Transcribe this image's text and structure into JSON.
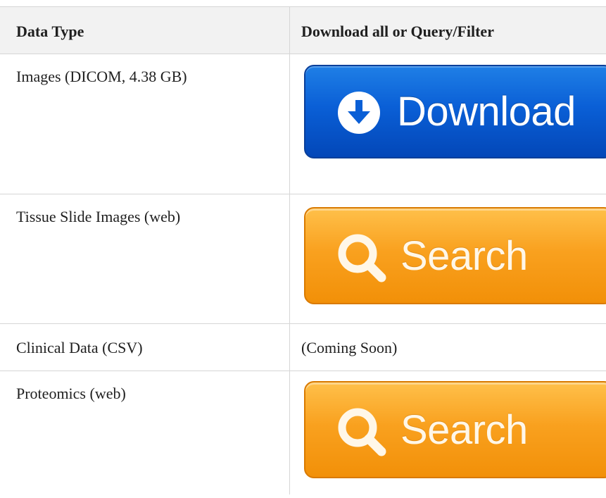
{
  "table": {
    "headers": [
      "Data Type",
      "Download all or Query/Filter"
    ],
    "rows": [
      {
        "data_type": "Images (DICOM, 4.38 GB)",
        "action": {
          "kind": "button",
          "label": "Download",
          "icon": "download-circle-icon",
          "color": "#0a5fd6"
        }
      },
      {
        "data_type": "Tissue Slide Images (web)",
        "action": {
          "kind": "button",
          "label": "Search",
          "icon": "search-icon",
          "color": "#f9a11f"
        }
      },
      {
        "data_type": "Clinical Data (CSV)",
        "action": {
          "kind": "text",
          "label": "(Coming Soon)"
        }
      },
      {
        "data_type": "Proteomics (web)",
        "action": {
          "kind": "button",
          "label": "Search",
          "icon": "search-icon",
          "color": "#f9a11f"
        }
      }
    ]
  },
  "colors": {
    "header_bg": "#f2f2f2",
    "border": "#d6d6d6",
    "download_blue": "#0a5fd6",
    "search_orange": "#f9a11f"
  }
}
